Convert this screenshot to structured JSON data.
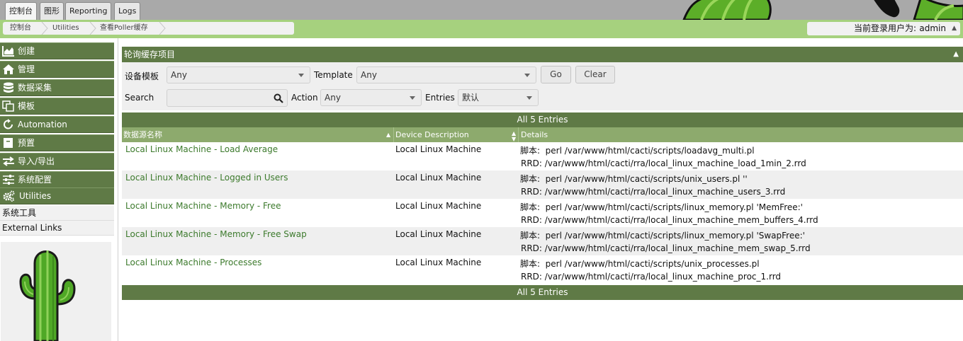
{
  "top_tabs": [
    {
      "label": "控制台",
      "active": true
    },
    {
      "label": "图形",
      "active": false
    },
    {
      "label": "Reporting",
      "active": false
    },
    {
      "label": "Logs",
      "active": false
    }
  ],
  "breadcrumb": [
    "控制台",
    "Utilities",
    "查看Poller缓存"
  ],
  "login": {
    "label": "当前登录用户为:",
    "user": "admin"
  },
  "sidebar": {
    "menu": [
      {
        "label": "创建",
        "icon": "chart-area-icon"
      },
      {
        "label": "管理",
        "icon": "home-icon"
      },
      {
        "label": "数据采集",
        "icon": "database-icon"
      },
      {
        "label": "模板",
        "icon": "copy-icon"
      },
      {
        "label": "Automation",
        "icon": "refresh-icon"
      },
      {
        "label": "预置",
        "icon": "preset-icon"
      },
      {
        "label": "导入/导出",
        "icon": "exchange-icon"
      },
      {
        "label": "系统配置",
        "icon": "sliders-icon"
      },
      {
        "label": "Utilities",
        "icon": "cogs-icon"
      }
    ],
    "submenu": [
      "系统工具",
      "External Links"
    ]
  },
  "panel": {
    "title": "轮询缓存项目"
  },
  "filter": {
    "device_label": "设备模板",
    "device_value": "Any",
    "template_label": "Template",
    "template_value": "Any",
    "go_label": "Go",
    "clear_label": "Clear",
    "search_label": "Search",
    "search_value": "",
    "action_label": "Action",
    "action_value": "Any",
    "entries_label": "Entries",
    "entries_value": "默认"
  },
  "entries_text": "All 5 Entries",
  "columns": [
    "数据源名称",
    "Device Description",
    "Details"
  ],
  "rows": [
    {
      "name": "Local Linux Machine - Load Average",
      "device": "Local Linux Machine",
      "d1": "脚本:  perl /var/www/html/cacti/scripts/loadavg_multi.pl",
      "d2": "RRD: /var/www/html/cacti/rra/local_linux_machine_load_1min_2.rrd"
    },
    {
      "name": "Local Linux Machine - Logged in Users",
      "device": "Local Linux Machine",
      "d1": "脚本:  perl /var/www/html/cacti/scripts/unix_users.pl ''",
      "d2": "RRD: /var/www/html/cacti/rra/local_linux_machine_users_3.rrd"
    },
    {
      "name": "Local Linux Machine - Memory - Free",
      "device": "Local Linux Machine",
      "d1": "脚本:  perl /var/www/html/cacti/scripts/linux_memory.pl 'MemFree:'",
      "d2": "RRD: /var/www/html/cacti/rra/local_linux_machine_mem_buffers_4.rrd"
    },
    {
      "name": "Local Linux Machine - Memory - Free Swap",
      "device": "Local Linux Machine",
      "d1": "脚本:  perl /var/www/html/cacti/scripts/linux_memory.pl 'SwapFree:'",
      "d2": "RRD: /var/www/html/cacti/rra/local_linux_machine_mem_swap_5.rrd"
    },
    {
      "name": "Local Linux Machine - Processes",
      "device": "Local Linux Machine",
      "d1": "脚本:  perl /var/www/html/cacti/scripts/unix_processes.pl",
      "d2": "RRD: /var/www/html/cacti/rra/local_linux_machine_proc_1.rrd"
    }
  ],
  "colors": {
    "menu_green": "#5f7a46",
    "nav_green": "#a6d17e",
    "link_green": "#3c7a2c"
  }
}
